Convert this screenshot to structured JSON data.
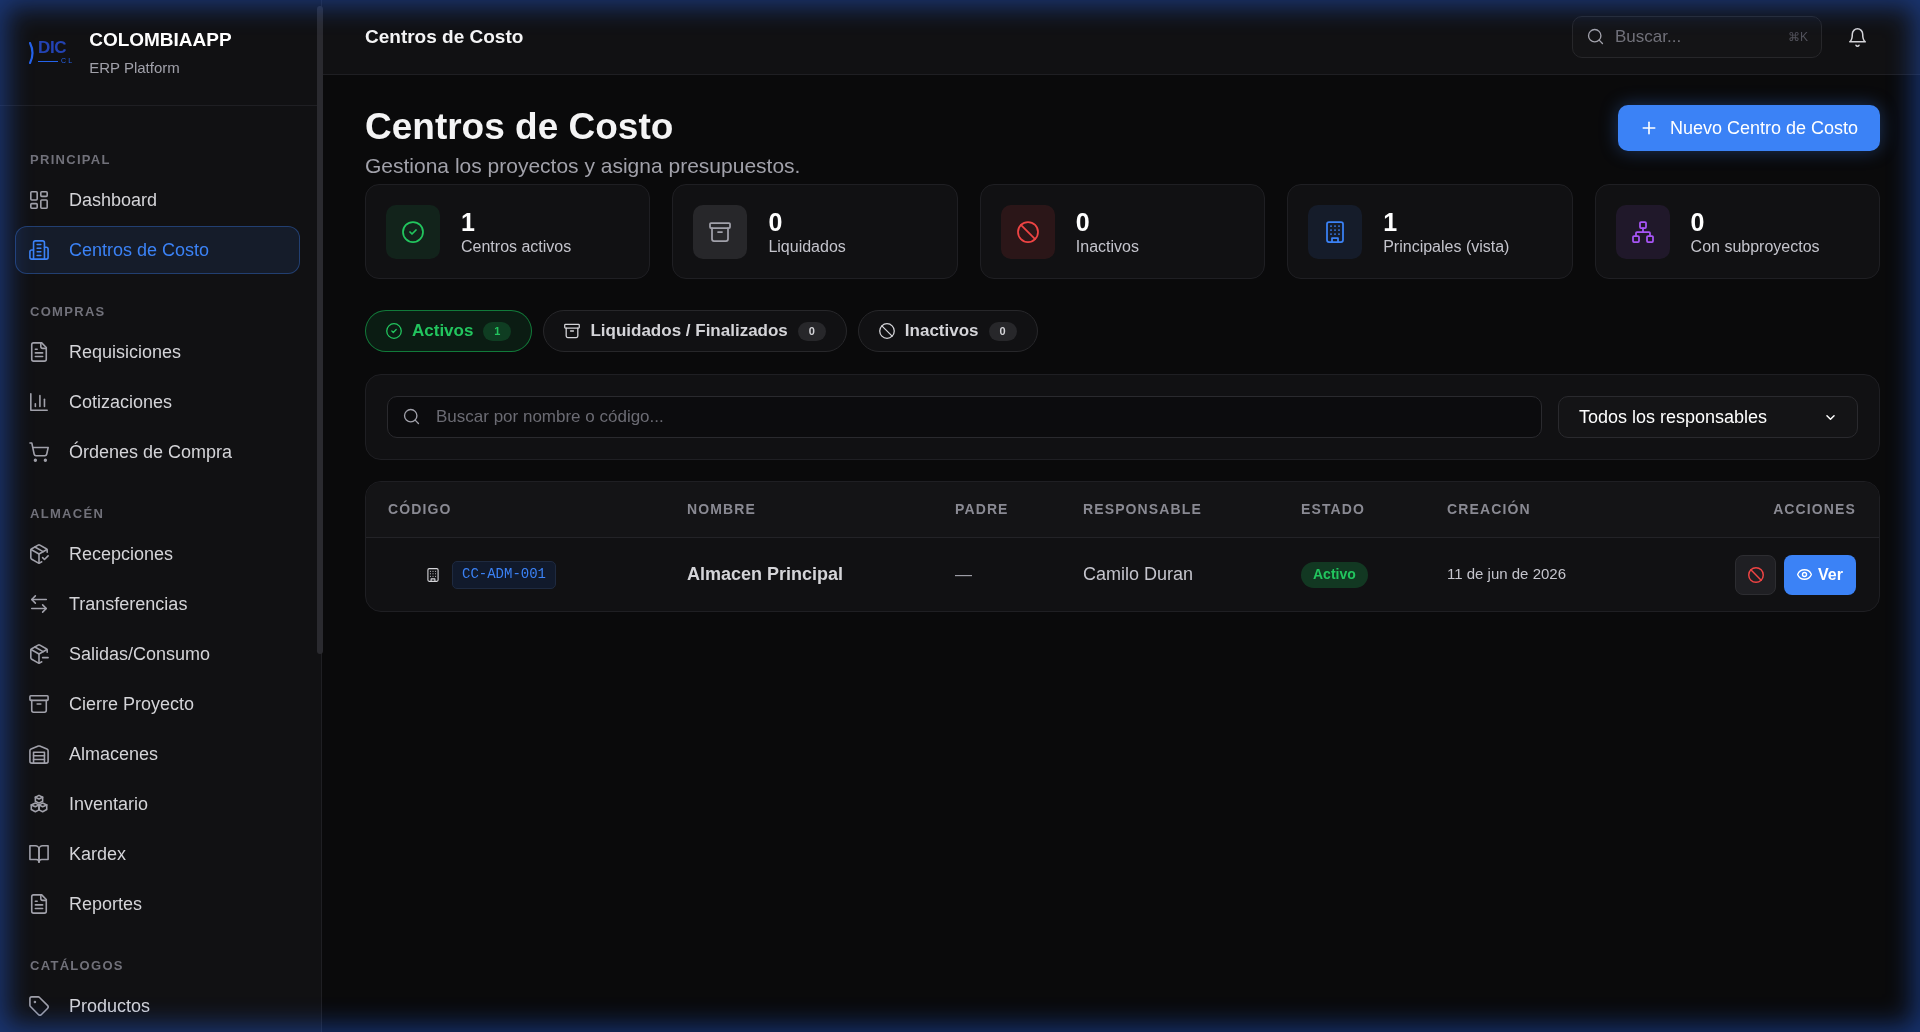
{
  "sidebar": {
    "brand": {
      "logo_text": "DIC",
      "logo_subtext": "CL",
      "title": "COLOMBIAAPP",
      "subtitle": "ERP Platform"
    },
    "sections": [
      {
        "heading": "PRINCIPAL",
        "items": [
          {
            "label": "Dashboard",
            "selected": false
          },
          {
            "label": "Centros de Costo",
            "selected": true
          }
        ]
      },
      {
        "heading": "COMPRAS",
        "items": [
          {
            "label": "Requisiciones",
            "selected": false
          },
          {
            "label": "Cotizaciones",
            "selected": false
          },
          {
            "label": "Órdenes de Compra",
            "selected": false
          }
        ]
      },
      {
        "heading": "ALMACÉN",
        "items": [
          {
            "label": "Recepciones",
            "selected": false
          },
          {
            "label": "Transferencias",
            "selected": false
          },
          {
            "label": "Salidas/Consumo",
            "selected": false
          },
          {
            "label": "Cierre Proyecto",
            "selected": false
          },
          {
            "label": "Almacenes",
            "selected": false
          },
          {
            "label": "Inventario",
            "selected": false
          },
          {
            "label": "Kardex",
            "selected": false
          },
          {
            "label": "Reportes",
            "selected": false
          }
        ]
      },
      {
        "heading": "CATÁLOGOS",
        "items": [
          {
            "label": "Productos",
            "selected": false
          }
        ]
      }
    ]
  },
  "header": {
    "title": "Centros de Costo",
    "search": {
      "placeholder": "Buscar...",
      "shortcut": "⌘K"
    }
  },
  "page": {
    "title": "Centros de Costo",
    "subtitle": "Gestiona los proyectos y asigna presupuestos.",
    "new_button": "Nuevo Centro de Costo"
  },
  "stats": [
    {
      "value": "1",
      "label": "Centros activos"
    },
    {
      "value": "0",
      "label": "Liquidados"
    },
    {
      "value": "0",
      "label": "Inactivos"
    },
    {
      "value": "1",
      "label": "Principales (vista)"
    },
    {
      "value": "0",
      "label": "Con subproyectos"
    }
  ],
  "tabs": [
    {
      "label": "Activos",
      "count": "1",
      "selected": true
    },
    {
      "label": "Liquidados / Finalizados",
      "count": "0",
      "selected": false
    },
    {
      "label": "Inactivos",
      "count": "0",
      "selected": false
    }
  ],
  "filters": {
    "search": {
      "placeholder": "Buscar por nombre o código..."
    },
    "responsible": {
      "value": "Todos los responsables"
    }
  },
  "table": {
    "columns": [
      "CÓDIGO",
      "NOMBRE",
      "PADRE",
      "RESPONSABLE",
      "ESTADO",
      "CREACIÓN",
      "ACCIONES"
    ],
    "rows": [
      {
        "code": "CC-ADM-001",
        "name": "Almacen Principal",
        "parent": "—",
        "responsible": "Camilo Duran",
        "status": "Activo",
        "created": "11 de jun de 2026",
        "view_button": "Ver"
      }
    ]
  }
}
